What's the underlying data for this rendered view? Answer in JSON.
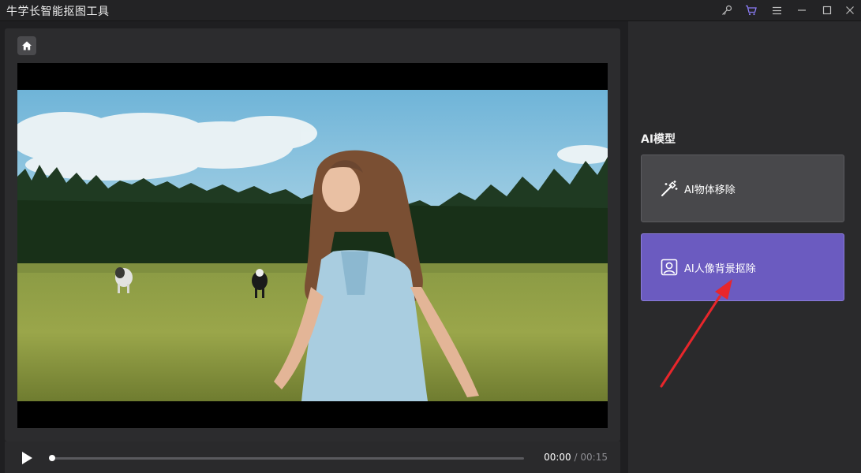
{
  "app": {
    "title": "牛学长智能抠图工具"
  },
  "titlebar": {
    "icons": [
      "key-icon",
      "cart-icon",
      "menu-icon",
      "minimize-icon",
      "maximize-icon",
      "close-icon"
    ],
    "cart_color": "#8b7cf6"
  },
  "player": {
    "current_time": "00:00",
    "separator": "/",
    "total_time": "00:15",
    "progress": 0
  },
  "models": {
    "section_title": "AI模型",
    "items": [
      {
        "label": "AI物体移除",
        "icon": "magic-wand-icon",
        "selected": false
      },
      {
        "label": "AI人像背景抠除",
        "icon": "portrait-icon",
        "selected": true
      }
    ]
  },
  "colors": {
    "accent": "#6b5bc0",
    "annotation": "#e8262b"
  }
}
